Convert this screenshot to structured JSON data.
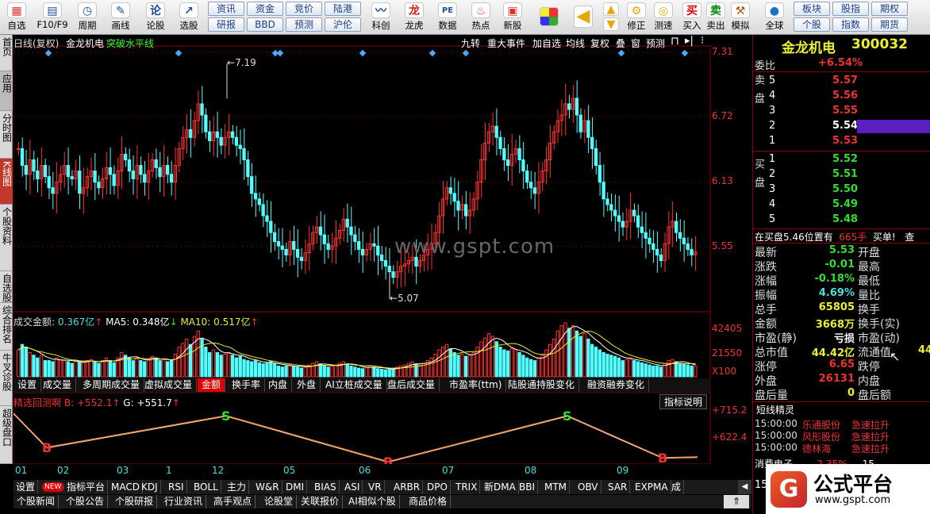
{
  "toolbar": {
    "items": [
      {
        "label": "自选",
        "icon": "grid-icon"
      },
      {
        "label": "F10/F9",
        "icon": "f10-icon"
      },
      {
        "label": "周期",
        "icon": "clock-icon"
      },
      {
        "label": "画线",
        "icon": "pencil-icon"
      },
      {
        "label": "论股",
        "icon": "discuss-icon"
      },
      {
        "label": "选股",
        "icon": "select-stock-icon"
      }
    ],
    "grid_buttons": [
      [
        "资讯",
        "资金",
        "竞价",
        "陆港"
      ],
      [
        "研报",
        "BBD",
        "预测",
        "沪伦"
      ]
    ],
    "icon_items": [
      {
        "label": "科创",
        "icon": "sci-tech-icon"
      },
      {
        "label": "龙虎",
        "icon": "dragon-tiger-icon"
      },
      {
        "label": "数据",
        "icon": "pe-data-icon"
      },
      {
        "label": "热点",
        "icon": "hot-icon"
      },
      {
        "label": "新股",
        "icon": "new-stock-icon"
      }
    ],
    "right_items": [
      {
        "label": "修正",
        "icon": "fix-icon"
      },
      {
        "label": "测速",
        "icon": "speed-test-icon"
      },
      {
        "label": "买入",
        "icon": "buy-icon"
      },
      {
        "label": "卖出",
        "icon": "sell-icon"
      },
      {
        "label": "模拟",
        "icon": "simulate-icon"
      },
      {
        "label": "全球",
        "icon": "globe-icon"
      }
    ],
    "buy_glyph": "买",
    "sell_glyph": "卖",
    "right_grid": [
      [
        "板块",
        "股指",
        "期权"
      ],
      [
        "个股",
        "指数",
        "期货"
      ]
    ]
  },
  "leftnav": [
    "首页",
    "应用",
    "分时图",
    "K线图",
    "个股资料",
    "自选股",
    "综合排名",
    "牛叉诊股",
    "超级盘口"
  ],
  "chart_header": {
    "title": "日线(复权)",
    "stock": "金龙机电",
    "indicator": "突破水平线",
    "tools": [
      "九转",
      "重大事件",
      "加自选",
      "均线",
      "复权",
      "叠",
      "窗",
      "预测"
    ]
  },
  "price_axis": [
    "7.31",
    "6.72",
    "6.13",
    "5.55"
  ],
  "annotations": {
    "high": "7.19",
    "low": "5.07"
  },
  "watermark": "www.gspt.com",
  "volume_panel": {
    "label": "成交金额:",
    "value": "0.367亿",
    "ma5_label": "MA5:",
    "ma5": "0.348亿",
    "ma10_label": "MA10:",
    "ma10": "0.517亿",
    "axis": [
      "42405",
      "21550",
      "X100"
    ]
  },
  "subtabs": [
    "设置",
    "成交量",
    "多周期成交量",
    "虚拟成交量",
    "金额",
    "换手率",
    "内盘",
    "外盘",
    "AI立桩成交量",
    "盘后成交量",
    "市盈率(ttm)",
    "陆股通持股变化",
    "融资融券变化"
  ],
  "indicator_panel": {
    "name": "精选回测啊",
    "b_label": "B:",
    "b": "+552.1",
    "g_label": "G:",
    "g": "+551.7",
    "explain": "指标说明",
    "axis": [
      "+715.2",
      "+622.4"
    ],
    "markers": [
      "B",
      "S",
      "B",
      "S",
      "B"
    ]
  },
  "months": [
    "01",
    "02",
    "03",
    "1",
    "12",
    "05",
    "06",
    "07",
    "08",
    "09"
  ],
  "indicator_tabs": [
    "设置",
    "NEW",
    "指标平台",
    "MACD",
    "KDJ",
    "RSI",
    "BOLL",
    "主力",
    "W&R",
    "DMI",
    "BIAS",
    "ASI",
    "VR",
    "ARBR",
    "DPO",
    "TRIX",
    "新DMA",
    "BBI",
    "MTM",
    "OBV",
    "SAR",
    "EXPMA",
    "成"
  ],
  "news_tabs": [
    "个股新闻",
    "个股公告",
    "个股研报",
    "行业资讯",
    "高手观点",
    "论股堂",
    "关联报价",
    "AI相似个股",
    "商品价格"
  ],
  "quote": {
    "name": "金龙机电",
    "code": "300032",
    "weibi_label": "委比",
    "weibi": "+6.54%",
    "sell_label": "卖盘",
    "buy_label": "买盘",
    "asks": [
      {
        "lvl": "5",
        "price": "5.57"
      },
      {
        "lvl": "4",
        "price": "5.56"
      },
      {
        "lvl": "3",
        "price": "5.55"
      },
      {
        "lvl": "2",
        "price": "5.54"
      },
      {
        "lvl": "1",
        "price": "5.53"
      }
    ],
    "bids": [
      {
        "lvl": "1",
        "price": "5.52"
      },
      {
        "lvl": "2",
        "price": "5.51"
      },
      {
        "lvl": "3",
        "price": "5.50"
      },
      {
        "lvl": "4",
        "price": "5.49"
      },
      {
        "lvl": "5",
        "price": "5.48"
      }
    ],
    "notice_a": "在买盘5.46位置有",
    "notice_b": "665手",
    "notice_c": "买单!",
    "notice_d": "查",
    "stats": [
      {
        "k": "最新",
        "v": "5.53",
        "k2": "开盘"
      },
      {
        "k": "涨跌",
        "v": "-0.01",
        "k2": "最高"
      },
      {
        "k": "涨幅",
        "v": "-0.18%",
        "k2": "最低"
      },
      {
        "k": "振幅",
        "v": "4.69%",
        "k2": "量比"
      },
      {
        "k": "总手",
        "v": "65805",
        "k2": "换手"
      },
      {
        "k": "金额",
        "v": "3668万",
        "k2": "换手(实)"
      },
      {
        "k": "市盈(静)",
        "v": "亏损",
        "k2": "市盈(动)"
      },
      {
        "k": "总市值",
        "v": "44.42亿",
        "k2": "流通值",
        "v2": "44"
      },
      {
        "k": "涨停",
        "v": "6.65",
        "k2": "跌停"
      },
      {
        "k": "外盘",
        "v": "26131",
        "k2": "内盘"
      },
      {
        "k": "盘后量",
        "v": "0",
        "k2": "盘后额"
      }
    ],
    "short_title": "短线精灵",
    "short_rows": [
      {
        "time": "15:00:00",
        "name": "乐通股份",
        "evt": "急速拉升"
      },
      {
        "time": "15:00:00",
        "name": "风形股份",
        "evt": "急速拉升"
      },
      {
        "time": "15:00:00",
        "name": "德林海",
        "evt": "急速拉升"
      }
    ],
    "partial_a": "消费电子",
    "partial_b": "2.35%",
    "partial_c": "15"
  },
  "brand": {
    "name": "公式平台",
    "url": "www.gspt.com",
    "logo": "G"
  },
  "chart_data": {
    "type": "candlestick",
    "title": "日线(复权) 金龙机电",
    "ylim": [
      5.0,
      7.31
    ],
    "y_ticks": [
      7.31,
      6.72,
      6.13,
      5.55
    ],
    "annotations": [
      {
        "label": "7.19",
        "value": 7.19
      },
      {
        "label": "5.07",
        "value": 5.07
      }
    ],
    "x_month_labels": [
      "01",
      "02",
      "03",
      "1",
      "12",
      "05",
      "06",
      "07",
      "08",
      "09"
    ],
    "volume_ticks": [
      42405,
      21550
    ],
    "volume_unit": "X100",
    "indicator_ticks": [
      715.2,
      622.4
    ],
    "closes": [
      6.45,
      6.3,
      6.22,
      6.35,
      6.25,
      6.18,
      6.3,
      6.2,
      6.1,
      6.05,
      6.15,
      6.22,
      6.3,
      6.2,
      6.18,
      6.25,
      6.05,
      6.1,
      6.2,
      6.25,
      6.15,
      6.1,
      6.18,
      6.28,
      6.22,
      6.12,
      6.25,
      6.4,
      6.35,
      6.25,
      6.18,
      6.3,
      6.22,
      6.15,
      6.25,
      6.35,
      6.28,
      6.2,
      6.3,
      6.22,
      6.15,
      6.3,
      6.45,
      6.55,
      6.62,
      6.55,
      6.7,
      6.85,
      6.75,
      6.6,
      6.52,
      6.6,
      6.55,
      6.48,
      6.55,
      6.6,
      6.55,
      6.48,
      6.45,
      6.35,
      6.2,
      6.05,
      6.0,
      5.95,
      5.85,
      5.8,
      5.7,
      5.62,
      5.58,
      5.55,
      5.5,
      5.62,
      5.55,
      5.48,
      5.45,
      5.52,
      5.6,
      5.7,
      5.75,
      5.68,
      5.6,
      5.55,
      5.58,
      5.65,
      5.72,
      5.82,
      5.75,
      5.68,
      5.62,
      5.55,
      5.5,
      5.55,
      5.6,
      5.58,
      5.5,
      5.45,
      5.4,
      5.35,
      5.3,
      5.35,
      5.4,
      5.42,
      5.45,
      5.48,
      5.4,
      5.45,
      5.5,
      5.55,
      5.6,
      5.7,
      5.85,
      6.0,
      6.1,
      6.05,
      5.98,
      5.9,
      5.95,
      5.85,
      5.9,
      6.0,
      6.15,
      6.35,
      6.5,
      6.6,
      6.65,
      6.55,
      6.45,
      6.35,
      6.3,
      6.4,
      6.45,
      6.35,
      6.25,
      6.15,
      6.1,
      6.05,
      6.15,
      6.25,
      6.35,
      6.5,
      6.6,
      6.7,
      6.75,
      6.85,
      6.8,
      6.9,
      6.75,
      6.6,
      6.7,
      6.55,
      6.45,
      6.3,
      6.15,
      6.0,
      5.95,
      5.9,
      5.85,
      5.8,
      5.75,
      5.8,
      5.9,
      5.85,
      5.75,
      5.7,
      5.65,
      5.6,
      5.55,
      5.5,
      5.45,
      5.6,
      5.75,
      5.8,
      5.7,
      5.65,
      5.6,
      5.55,
      5.5,
      5.53
    ],
    "volume_series": {
      "name": "成交金额",
      "values": [
        0.5,
        0.6,
        0.55,
        0.45,
        0.4,
        0.35,
        0.4,
        0.3,
        0.3,
        0.28,
        0.35,
        0.32,
        0.3,
        0.28,
        0.25,
        0.3,
        0.28,
        0.26,
        0.3,
        0.32,
        0.28,
        0.25,
        0.3,
        0.35,
        0.3,
        0.26,
        0.35,
        0.45,
        0.4,
        0.35,
        0.3,
        0.35,
        0.3,
        0.28,
        0.32,
        0.38,
        0.35,
        0.3,
        0.32,
        0.28,
        0.3,
        0.42,
        0.55,
        0.62,
        0.7,
        0.6,
        0.75,
        0.85,
        0.7,
        0.55,
        0.45,
        0.5,
        0.45,
        0.4,
        0.42,
        0.45,
        0.4,
        0.35,
        0.38,
        0.32,
        0.3,
        0.28,
        0.3,
        0.26,
        0.24,
        0.25,
        0.28,
        0.24,
        0.2,
        0.18,
        0.2,
        0.22,
        0.2,
        0.18,
        0.16,
        0.18,
        0.22,
        0.25,
        0.28,
        0.24,
        0.2,
        0.18,
        0.2,
        0.22,
        0.25,
        0.28,
        0.24,
        0.2,
        0.18,
        0.16,
        0.15,
        0.18,
        0.2,
        0.18,
        0.15,
        0.14,
        0.13,
        0.14,
        0.16,
        0.18,
        0.2,
        0.22,
        0.25,
        0.28,
        0.24,
        0.22,
        0.25,
        0.3,
        0.35,
        0.42,
        0.5,
        0.55,
        0.6,
        0.52,
        0.45,
        0.4,
        0.42,
        0.38,
        0.4,
        0.45,
        0.55,
        0.65,
        0.72,
        0.8,
        0.75,
        0.65,
        0.55,
        0.5,
        0.48,
        0.52,
        0.5,
        0.45,
        0.4,
        0.35,
        0.32,
        0.3,
        0.35,
        0.42,
        0.5,
        0.6,
        0.7,
        0.85,
        0.95,
        1.0,
        0.9,
        0.95,
        0.85,
        0.75,
        0.8,
        0.7,
        0.6,
        0.55,
        0.5,
        0.45,
        0.42,
        0.4,
        0.38,
        0.35,
        0.3,
        0.32,
        0.35,
        0.3,
        0.28,
        0.26,
        0.24,
        0.22,
        0.2,
        0.2,
        0.18,
        0.25,
        0.3,
        0.32,
        0.28,
        0.25,
        0.24,
        0.22,
        0.2,
        0.2
      ]
    }
  }
}
